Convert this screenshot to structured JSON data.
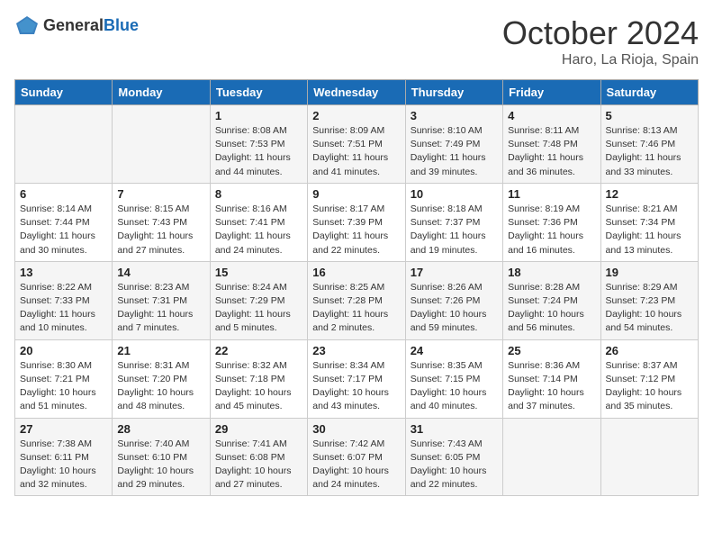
{
  "header": {
    "logo_general": "General",
    "logo_blue": "Blue",
    "month": "October 2024",
    "location": "Haro, La Rioja, Spain"
  },
  "weekdays": [
    "Sunday",
    "Monday",
    "Tuesday",
    "Wednesday",
    "Thursday",
    "Friday",
    "Saturday"
  ],
  "weeks": [
    [
      {
        "day": "",
        "info": ""
      },
      {
        "day": "",
        "info": ""
      },
      {
        "day": "1",
        "info": "Sunrise: 8:08 AM\nSunset: 7:53 PM\nDaylight: 11 hours and 44 minutes."
      },
      {
        "day": "2",
        "info": "Sunrise: 8:09 AM\nSunset: 7:51 PM\nDaylight: 11 hours and 41 minutes."
      },
      {
        "day": "3",
        "info": "Sunrise: 8:10 AM\nSunset: 7:49 PM\nDaylight: 11 hours and 39 minutes."
      },
      {
        "day": "4",
        "info": "Sunrise: 8:11 AM\nSunset: 7:48 PM\nDaylight: 11 hours and 36 minutes."
      },
      {
        "day": "5",
        "info": "Sunrise: 8:13 AM\nSunset: 7:46 PM\nDaylight: 11 hours and 33 minutes."
      }
    ],
    [
      {
        "day": "6",
        "info": "Sunrise: 8:14 AM\nSunset: 7:44 PM\nDaylight: 11 hours and 30 minutes."
      },
      {
        "day": "7",
        "info": "Sunrise: 8:15 AM\nSunset: 7:43 PM\nDaylight: 11 hours and 27 minutes."
      },
      {
        "day": "8",
        "info": "Sunrise: 8:16 AM\nSunset: 7:41 PM\nDaylight: 11 hours and 24 minutes."
      },
      {
        "day": "9",
        "info": "Sunrise: 8:17 AM\nSunset: 7:39 PM\nDaylight: 11 hours and 22 minutes."
      },
      {
        "day": "10",
        "info": "Sunrise: 8:18 AM\nSunset: 7:37 PM\nDaylight: 11 hours and 19 minutes."
      },
      {
        "day": "11",
        "info": "Sunrise: 8:19 AM\nSunset: 7:36 PM\nDaylight: 11 hours and 16 minutes."
      },
      {
        "day": "12",
        "info": "Sunrise: 8:21 AM\nSunset: 7:34 PM\nDaylight: 11 hours and 13 minutes."
      }
    ],
    [
      {
        "day": "13",
        "info": "Sunrise: 8:22 AM\nSunset: 7:33 PM\nDaylight: 11 hours and 10 minutes."
      },
      {
        "day": "14",
        "info": "Sunrise: 8:23 AM\nSunset: 7:31 PM\nDaylight: 11 hours and 7 minutes."
      },
      {
        "day": "15",
        "info": "Sunrise: 8:24 AM\nSunset: 7:29 PM\nDaylight: 11 hours and 5 minutes."
      },
      {
        "day": "16",
        "info": "Sunrise: 8:25 AM\nSunset: 7:28 PM\nDaylight: 11 hours and 2 minutes."
      },
      {
        "day": "17",
        "info": "Sunrise: 8:26 AM\nSunset: 7:26 PM\nDaylight: 10 hours and 59 minutes."
      },
      {
        "day": "18",
        "info": "Sunrise: 8:28 AM\nSunset: 7:24 PM\nDaylight: 10 hours and 56 minutes."
      },
      {
        "day": "19",
        "info": "Sunrise: 8:29 AM\nSunset: 7:23 PM\nDaylight: 10 hours and 54 minutes."
      }
    ],
    [
      {
        "day": "20",
        "info": "Sunrise: 8:30 AM\nSunset: 7:21 PM\nDaylight: 10 hours and 51 minutes."
      },
      {
        "day": "21",
        "info": "Sunrise: 8:31 AM\nSunset: 7:20 PM\nDaylight: 10 hours and 48 minutes."
      },
      {
        "day": "22",
        "info": "Sunrise: 8:32 AM\nSunset: 7:18 PM\nDaylight: 10 hours and 45 minutes."
      },
      {
        "day": "23",
        "info": "Sunrise: 8:34 AM\nSunset: 7:17 PM\nDaylight: 10 hours and 43 minutes."
      },
      {
        "day": "24",
        "info": "Sunrise: 8:35 AM\nSunset: 7:15 PM\nDaylight: 10 hours and 40 minutes."
      },
      {
        "day": "25",
        "info": "Sunrise: 8:36 AM\nSunset: 7:14 PM\nDaylight: 10 hours and 37 minutes."
      },
      {
        "day": "26",
        "info": "Sunrise: 8:37 AM\nSunset: 7:12 PM\nDaylight: 10 hours and 35 minutes."
      }
    ],
    [
      {
        "day": "27",
        "info": "Sunrise: 7:38 AM\nSunset: 6:11 PM\nDaylight: 10 hours and 32 minutes."
      },
      {
        "day": "28",
        "info": "Sunrise: 7:40 AM\nSunset: 6:10 PM\nDaylight: 10 hours and 29 minutes."
      },
      {
        "day": "29",
        "info": "Sunrise: 7:41 AM\nSunset: 6:08 PM\nDaylight: 10 hours and 27 minutes."
      },
      {
        "day": "30",
        "info": "Sunrise: 7:42 AM\nSunset: 6:07 PM\nDaylight: 10 hours and 24 minutes."
      },
      {
        "day": "31",
        "info": "Sunrise: 7:43 AM\nSunset: 6:05 PM\nDaylight: 10 hours and 22 minutes."
      },
      {
        "day": "",
        "info": ""
      },
      {
        "day": "",
        "info": ""
      }
    ]
  ]
}
